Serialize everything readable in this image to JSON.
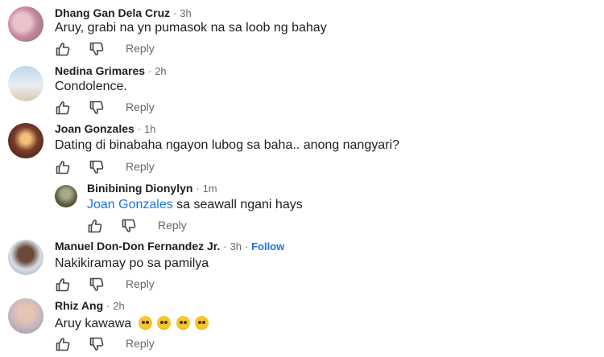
{
  "comments": [
    {
      "author": "Dhang Gan Dela Cruz",
      "time": "3h",
      "text": "Aruy, grabi na yn pumasok na sa loob ng bahay",
      "reply_label": "Reply"
    },
    {
      "author": "Nedina Grimares",
      "time": "2h",
      "text": "Condolence.",
      "reply_label": "Reply"
    },
    {
      "author": "Joan Gonzales",
      "time": "1h",
      "text": "Dating di binabaha ngayon lubog sa baha.. anong nangyari?",
      "reply_label": "Reply"
    },
    {
      "author": "Binibining Dionylyn",
      "time": "1m",
      "mention": "Joan Gonzales",
      "text": " sa seawall ngani hays",
      "reply_label": "Reply"
    },
    {
      "author": "Manuel Don-Don Fernandez Jr.",
      "time": "3h",
      "follow": "Follow",
      "text": "Nakikiramay po sa pamilya",
      "reply_label": "Reply"
    },
    {
      "author": "Rhiz Ang",
      "time": "2h",
      "text": "Aruy kawawa",
      "emojis": [
        "crying-face-emoji",
        "crying-face-emoji",
        "crying-face-emoji",
        "crying-face-emoji"
      ],
      "reply_label": "Reply"
    }
  ],
  "separator": "·",
  "icons": {
    "like": "thumbs-up-icon",
    "dislike": "thumbs-down-icon"
  },
  "colors": {
    "link": "#1b74e4",
    "meta": "#65676b"
  }
}
